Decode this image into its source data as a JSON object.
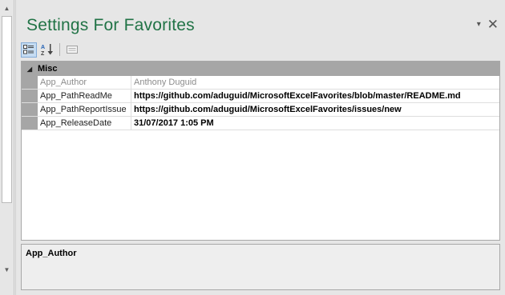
{
  "pane": {
    "title": "Settings For Favorites",
    "dropdown_icon": "▾",
    "close_icon": "✕"
  },
  "toolbar": {
    "categorized_icon": "categorized-view",
    "alphabetical_icon": "alphabetical-sort",
    "property_pages_icon": "property-pages"
  },
  "grid": {
    "category": {
      "label": "Misc",
      "toggle": "◢"
    },
    "rows": [
      {
        "name": "App_Author",
        "value": "Anthony Duguid",
        "readonly": true
      },
      {
        "name": "App_PathReadMe",
        "value": "https://github.com/aduguid/MicrosoftExcelFavorites/blob/master/README.md",
        "readonly": false
      },
      {
        "name": "App_PathReportIssue",
        "value": "https://github.com/aduguid/MicrosoftExcelFavorites/issues/new",
        "readonly": false
      },
      {
        "name": "App_ReleaseDate",
        "value": "31/07/2017 1:05 PM",
        "readonly": false
      }
    ]
  },
  "description": {
    "title": "App_Author"
  },
  "scrollbar": {
    "up": "▲",
    "down": "▼"
  },
  "colors": {
    "title": "#217346",
    "category_bg": "#a6a6a6",
    "readonly_text": "#8c8c8c"
  }
}
